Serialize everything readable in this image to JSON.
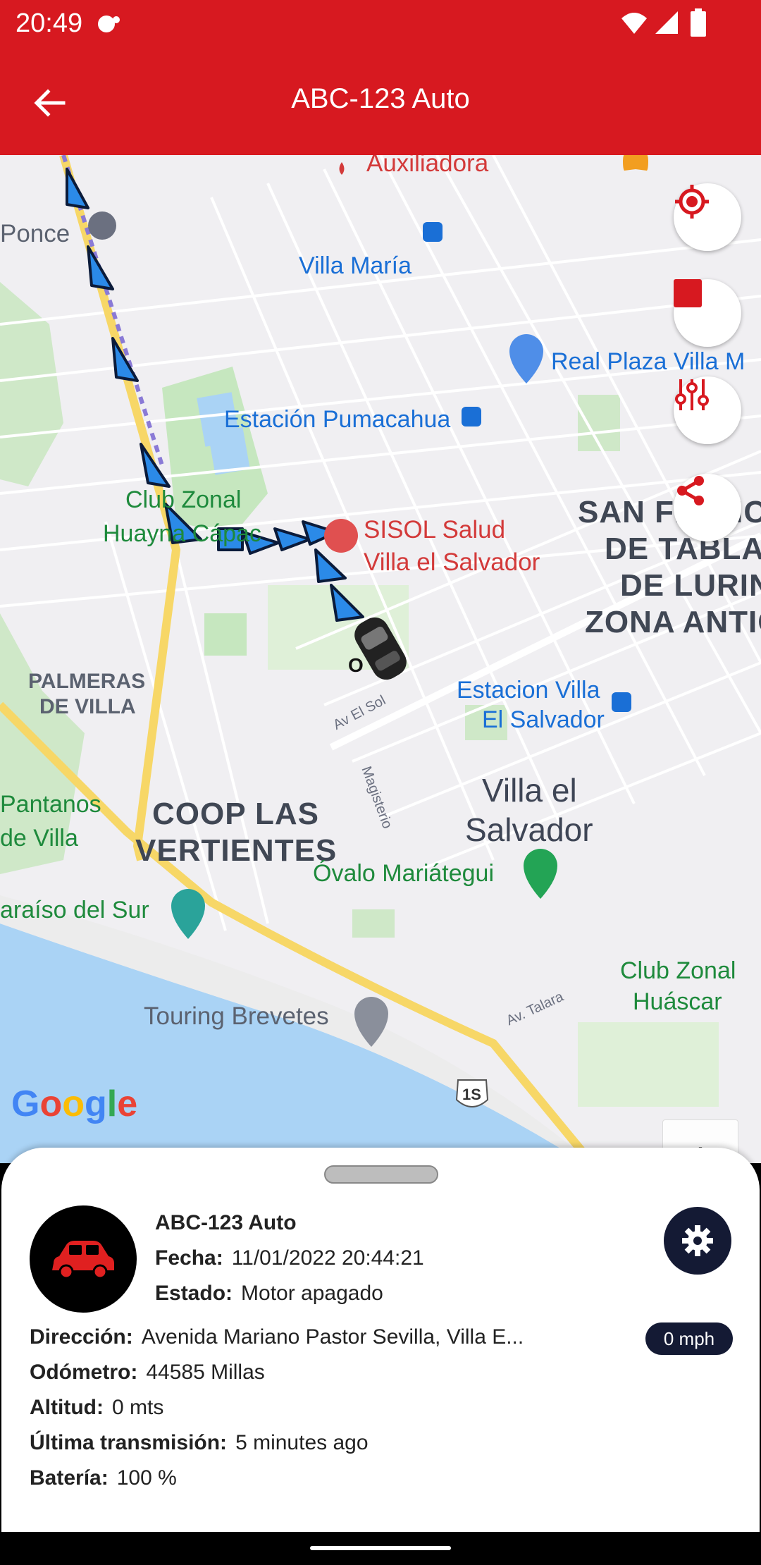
{
  "status_bar": {
    "time": "20:49"
  },
  "app_bar": {
    "title": "ABC-123 Auto"
  },
  "map": {
    "labels": {
      "auxiliadora": "Auxiliadora",
      "ponce": "Ponce",
      "villa_maria": "Villa María",
      "real_plaza": "Real Plaza Villa M",
      "estacion_pumacahua": "Estación Pumacahua",
      "club_zonal_1": "Club Zonal",
      "club_zonal_2": "Huayna Cápac",
      "sisol_1": "SISOL Salud",
      "sisol_2": "Villa el Salvador",
      "san_francisco_1": "SAN FRANCIS",
      "san_francisco_2": "DE TABLAD",
      "san_francisco_3": "DE LURIN",
      "san_francisco_4": "ZONA ANTIG",
      "palmeras_1": "PALMERAS",
      "palmeras_2": "DE VILLA",
      "estacion_villa_1": "Estacion Villa",
      "estacion_villa_2": "El Salvador",
      "av_el_sol": "Av El Sol",
      "magisterio": "Magisterio",
      "pantanos_1": "Pantanos",
      "pantanos_2": "de Villa",
      "coop_1": "COOP LAS",
      "coop_2": "VERTIENTES",
      "villa_salvador_1": "Villa el",
      "villa_salvador_2": "Salvador",
      "ovalo": "Óvalo Mariátegui",
      "paraiso": "araíso del Sur",
      "club_zonal_huascar_1": "Club Zonal",
      "club_zonal_huascar_2": "Huáscar",
      "av_talara": "Av. Talara",
      "touring": "Touring Brevetes",
      "highway": "1S",
      "vehicle_marker": "O"
    },
    "zoom_in": "+",
    "zoom_out": "−",
    "google": "Google"
  },
  "sheet": {
    "vehicle_name": "ABC-123 Auto",
    "fecha_label": "Fecha:",
    "fecha_value": "11/01/2022 20:44:21",
    "estado_label": "Estado:",
    "estado_value": "Motor apagado",
    "direccion_label": "Dirección:",
    "direccion_value": "Avenida Mariano Pastor Sevilla, Villa E...",
    "speed": "0 mph",
    "odometro_label": "Odómetro:",
    "odometro_value": "44585 Millas",
    "altitud_label": "Altitud:",
    "altitud_value": "0 mts",
    "ultima_label": "Última transmisión:",
    "ultima_value": "5 minutes ago",
    "bateria_label": "Batería:",
    "bateria_value": "100 %"
  },
  "colors": {
    "brand_red": "#d71920",
    "navy": "#141a34",
    "route_blue": "#2b8ae8"
  },
  "icons": [
    "back-arrow-icon",
    "wifi-icon",
    "signal-icon",
    "battery-icon",
    "locate-icon",
    "stop-icon",
    "filter-icon",
    "share-icon",
    "car-icon",
    "gear-icon"
  ]
}
